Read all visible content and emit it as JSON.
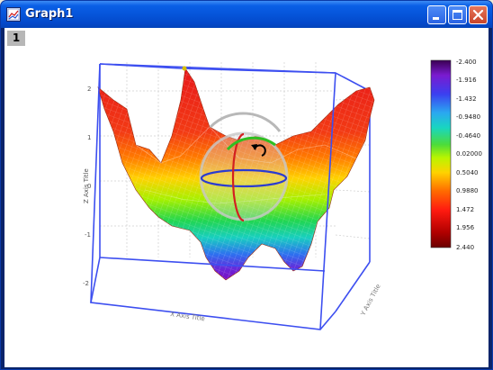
{
  "window": {
    "title": "Graph1",
    "minimize_label": "Minimize",
    "maximize_label": "Maximize",
    "close_label": "Close"
  },
  "page_tab": "1",
  "colors": {
    "titlebar": "#0553d8",
    "frame_box": "#3344ee",
    "colorbar": [
      "#7a0000",
      "#e41a1c",
      "#ff6a00",
      "#ffd200",
      "#b9f500",
      "#4cdc3a",
      "#19d6c0",
      "#2aa8f0",
      "#2b3be0",
      "#7a1bd0",
      "#3a0060"
    ]
  },
  "icons": [
    "graph-app-icon",
    "minimize-icon",
    "maximize-icon",
    "close-icon",
    "rotate-icon"
  ],
  "chart_data": {
    "type": "3d-surface",
    "z_title": "Z Axis Title",
    "x_title": "X Axis Title",
    "y_title": "Y Axis Title",
    "z_ticks": [
      "2",
      "1",
      "0",
      "-1",
      "-2"
    ],
    "colorbar_labels": [
      "-2.400",
      "-1.916",
      "-1.432",
      "-0.9480",
      "-0.4640",
      "0.02000",
      "0.5040",
      "0.9880",
      "1.472",
      "1.956",
      "2.440"
    ]
  }
}
